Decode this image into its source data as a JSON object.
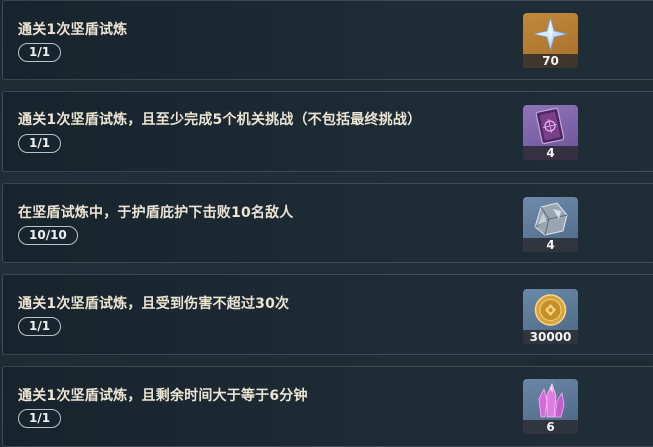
{
  "tasks": [
    {
      "title": "通关1次坚盾试炼",
      "progress": "1/1",
      "reward": {
        "item": "primogem",
        "icon": "primogem-icon",
        "count": "70"
      }
    },
    {
      "title": "通关1次坚盾试炼，且至少完成5个机关挑战（不包括最终挑战）",
      "progress": "1/1",
      "reward": {
        "item": "talent-book",
        "icon": "book-icon",
        "count": "4"
      }
    },
    {
      "title": "在坚盾试炼中，于护盾庇护下击败10名敌人",
      "progress": "10/10",
      "reward": {
        "item": "weapon-ore",
        "icon": "ore-icon",
        "count": "4"
      }
    },
    {
      "title": "通关1次坚盾试炼，且受到伤害不超过30次",
      "progress": "1/1",
      "reward": {
        "item": "mora",
        "icon": "mora-coin-icon",
        "count": "30000"
      }
    },
    {
      "title": "通关1次坚盾试炼，且剩余时间大于等于6分钟",
      "progress": "1/1",
      "reward": {
        "item": "crystal",
        "icon": "crystal-icon",
        "count": "6"
      }
    }
  ]
}
